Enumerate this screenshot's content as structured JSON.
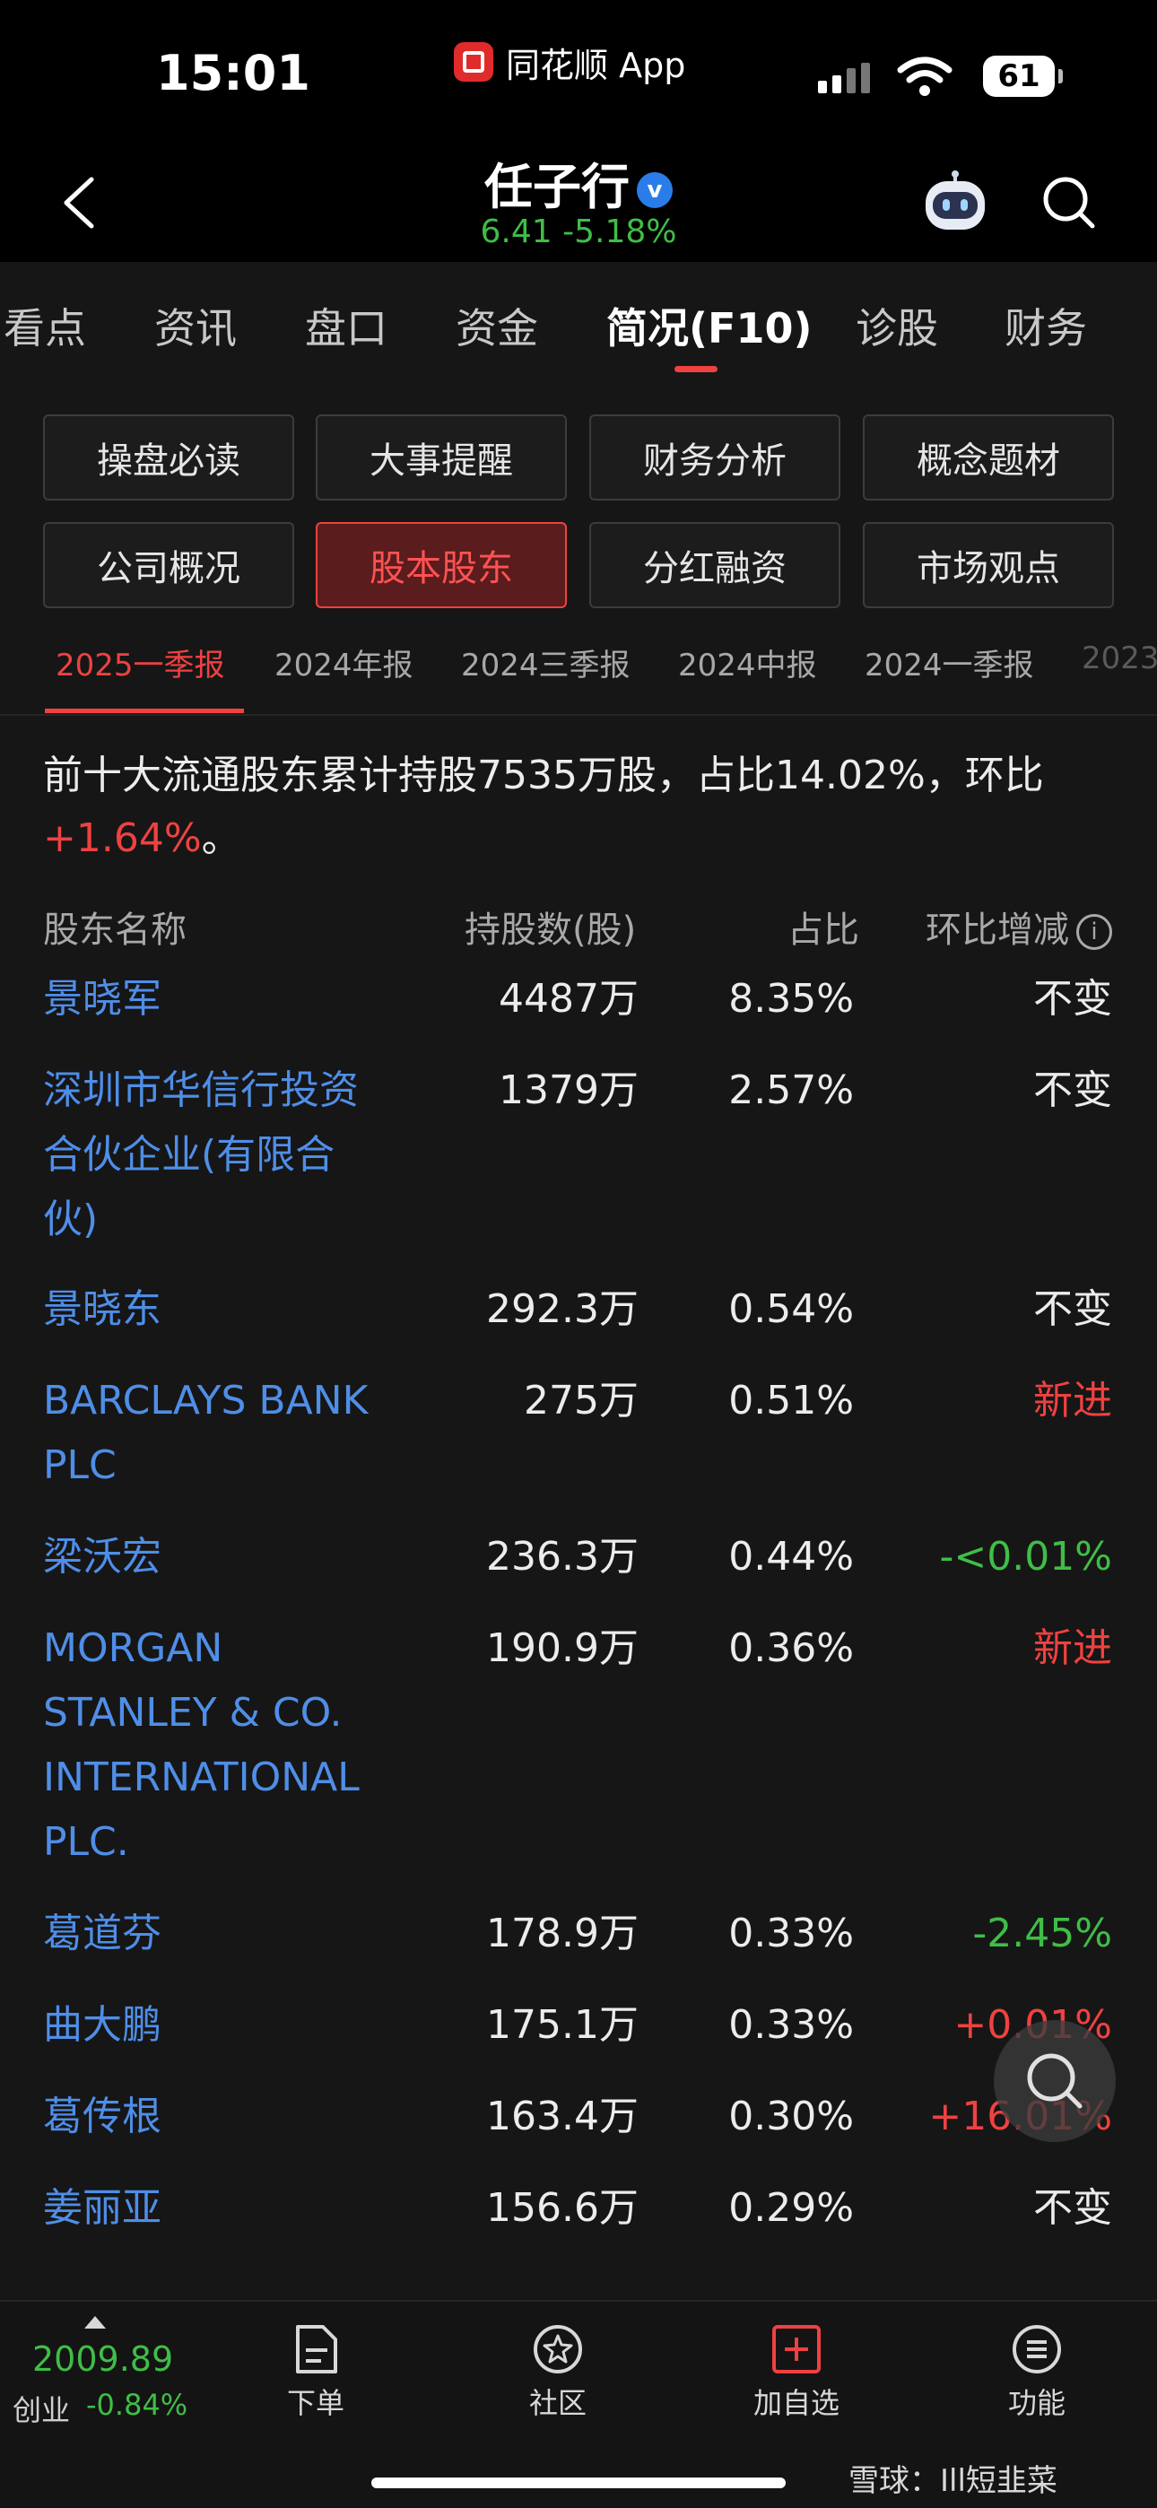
{
  "status_bar": {
    "time": "15:01",
    "app_name": "同花顺 App",
    "battery": "61"
  },
  "header": {
    "stock_name": "任子行",
    "verified_mark": "v",
    "price_change": "6.41 -5.18%"
  },
  "main_tabs": [
    "看点",
    "资讯",
    "盘口",
    "资金",
    "简况(F10)",
    "诊股",
    "财务"
  ],
  "active_tab": "简况(F10)",
  "sub_buttons": [
    "操盘必读",
    "大事提醒",
    "财务分析",
    "概念题材",
    "公司概况",
    "股本股东",
    "分红融资",
    "市场观点"
  ],
  "active_button": "股本股东",
  "periods": [
    "2025一季报",
    "2024年报",
    "2024三季报",
    "2024中报",
    "2024一季报",
    "2023"
  ],
  "active_period": "2025一季报",
  "summary": {
    "text": "前十大流通股东累计持股7535万股，占比14.02%，环比",
    "change": "+1.64%",
    "end": "。"
  },
  "table": {
    "headers": {
      "name": "股东名称",
      "shares": "持股数(股)",
      "pct": "占比",
      "change": "环比增减",
      "info_icon": "i"
    },
    "rows": [
      {
        "name": "景晓军",
        "shares": "4487万",
        "pct": "8.35%",
        "change": "不变",
        "tone": "neutral"
      },
      {
        "name": "深圳市华信行投资合伙企业(有限合伙)",
        "shares": "1379万",
        "pct": "2.57%",
        "change": "不变",
        "tone": "neutral"
      },
      {
        "name": "景晓东",
        "shares": "292.3万",
        "pct": "0.54%",
        "change": "不变",
        "tone": "neutral"
      },
      {
        "name": "BARCLAYS BANK PLC",
        "shares": "275万",
        "pct": "0.51%",
        "change": "新进",
        "tone": "red"
      },
      {
        "name": "梁沃宏",
        "shares": "236.3万",
        "pct": "0.44%",
        "change": "-<0.01%",
        "tone": "green"
      },
      {
        "name": "MORGAN STANLEY & CO. INTERNATIONAL PLC.",
        "shares": "190.9万",
        "pct": "0.36%",
        "change": "新进",
        "tone": "red"
      },
      {
        "name": "葛道芬",
        "shares": "178.9万",
        "pct": "0.33%",
        "change": "-2.45%",
        "tone": "green"
      },
      {
        "name": "曲大鹏",
        "shares": "175.1万",
        "pct": "0.33%",
        "change": "+0.01%",
        "tone": "red"
      },
      {
        "name": "葛传根",
        "shares": "163.4万",
        "pct": "0.30%",
        "change": "+16.01%",
        "tone": "red"
      },
      {
        "name": "姜丽亚",
        "shares": "156.6万",
        "pct": "0.29%",
        "change": "不变",
        "tone": "neutral"
      }
    ]
  },
  "bottom_bar": {
    "index_value": "2009.89",
    "index_name": "创业",
    "index_change": "-0.84%",
    "nav": [
      "下单",
      "社区",
      "加自选",
      "功能"
    ]
  },
  "watermark": "雪球：Ill短韭菜",
  "colors": {
    "up": "#f04141",
    "down": "#3fbe47",
    "link": "#4f8ee8"
  }
}
